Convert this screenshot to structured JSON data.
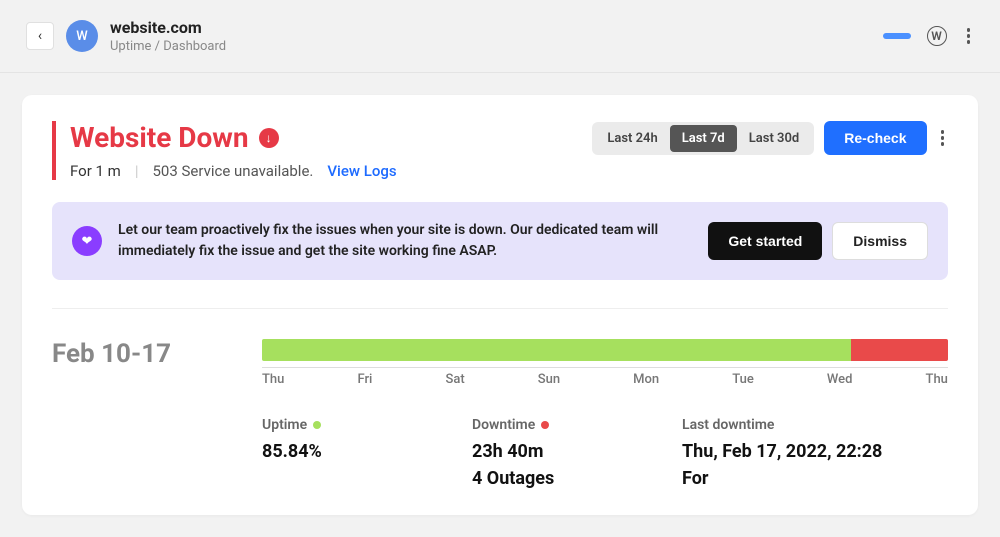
{
  "header": {
    "avatar_letter": "W",
    "site_title": "website.com",
    "breadcrumb": "Uptime / Dashboard"
  },
  "status": {
    "title": "Website Down",
    "for_label": "For 1 m",
    "error_message": "503 Service unavailable.",
    "view_logs": "View Logs"
  },
  "range": {
    "r1": "Last 24h",
    "r2": "Last 7d",
    "r3": "Last 30d"
  },
  "recheck_label": "Re-check",
  "banner": {
    "text": "Let our team proactively fix the issues when your site is down. Our dedicated team will immediately fix the issue and get the site working fine ASAP.",
    "get_started": "Get started",
    "dismiss": "Dismiss"
  },
  "chart": {
    "date_range": "Feb 10-17"
  },
  "chart_data": {
    "type": "bar",
    "categories": [
      "Thu",
      "Fri",
      "Sat",
      "Sun",
      "Mon",
      "Tue",
      "Wed",
      "Thu"
    ],
    "segments": [
      {
        "status": "up",
        "percent": 85.84,
        "color": "#a6e05e"
      },
      {
        "status": "down",
        "percent": 14.16,
        "color": "#e94a4a"
      }
    ],
    "title": "",
    "xlabel": "",
    "ylabel": ""
  },
  "stats": {
    "uptime_label": "Uptime",
    "uptime_value": "85.84%",
    "downtime_label": "Downtime",
    "downtime_value": "23h 40m",
    "outages_value": "4 Outages",
    "last_downtime_label": "Last downtime",
    "last_downtime_value": "Thu, Feb 17, 2022, 22:28",
    "last_downtime_for": "For"
  }
}
